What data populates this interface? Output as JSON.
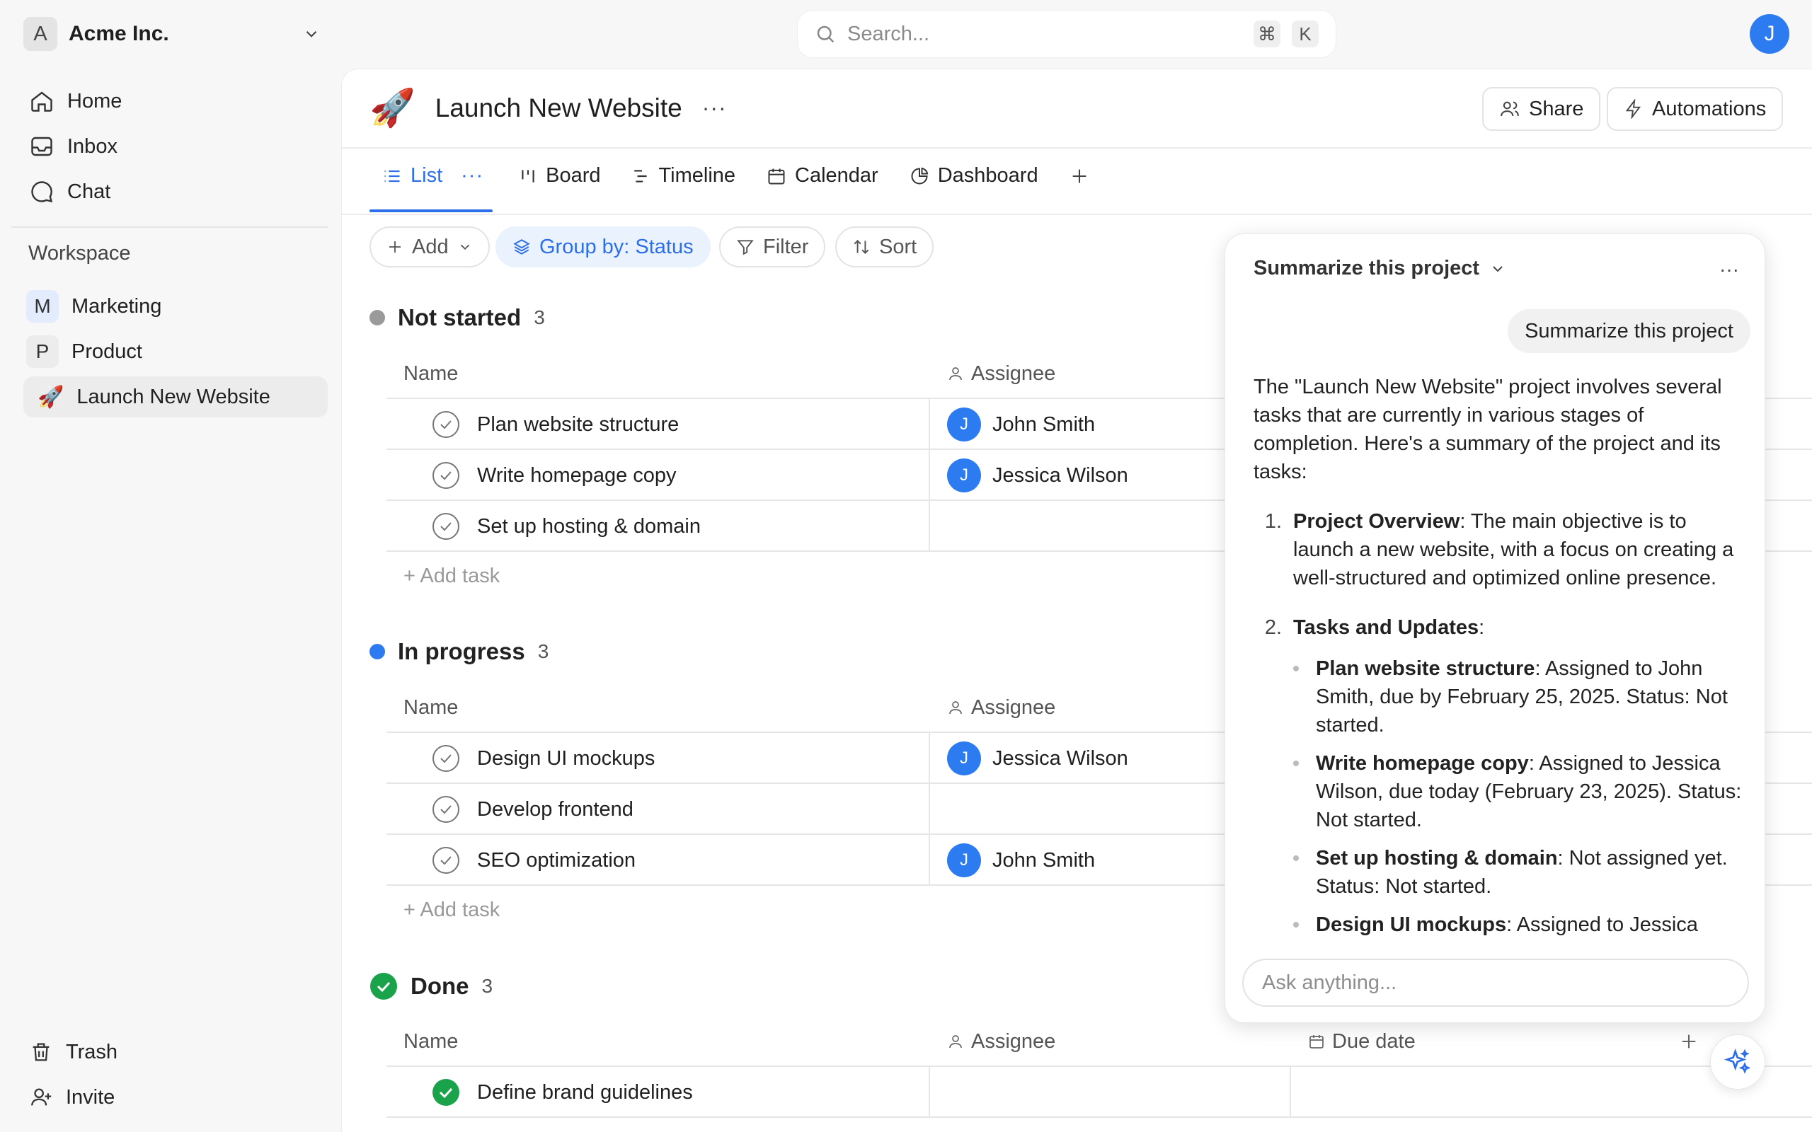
{
  "workspace": {
    "badge": "A",
    "name": "Acme Inc."
  },
  "search": {
    "placeholder": "Search...",
    "shortcut_cmd": "⌘",
    "shortcut_key": "K"
  },
  "user": {
    "initial": "J"
  },
  "sidebar": {
    "nav": [
      {
        "label": "Home"
      },
      {
        "label": "Inbox"
      },
      {
        "label": "Chat"
      }
    ],
    "workspace_heading": "Workspace",
    "workspace_items": [
      {
        "letter": "M",
        "label": "Marketing"
      },
      {
        "letter": "P",
        "label": "Product"
      },
      {
        "icon": "🚀",
        "label": "Launch New Website"
      }
    ],
    "bottom": [
      {
        "label": "Trash"
      },
      {
        "label": "Invite"
      }
    ]
  },
  "project": {
    "emoji": "🚀",
    "title": "Launch New Website",
    "more": "···",
    "share_label": "Share",
    "automations_label": "Automations"
  },
  "tabs": [
    {
      "label": "List",
      "more": "···"
    },
    {
      "label": "Board"
    },
    {
      "label": "Timeline"
    },
    {
      "label": "Calendar"
    },
    {
      "label": "Dashboard"
    }
  ],
  "toolbar": {
    "add_label": "Add",
    "group_label": "Group by: Status",
    "filter_label": "Filter",
    "sort_label": "Sort"
  },
  "columns": {
    "name": "Name",
    "assignee": "Assignee",
    "due": "Due date"
  },
  "groups": [
    {
      "title": "Not started",
      "count": "3",
      "add_task": "+ Add task",
      "tasks": [
        {
          "name": "Plan website structure",
          "assignee": "John Smith",
          "initial": "J"
        },
        {
          "name": "Write homepage copy",
          "assignee": "Jessica Wilson",
          "initial": "J"
        },
        {
          "name": "Set up hosting & domain",
          "assignee": "",
          "initial": ""
        }
      ]
    },
    {
      "title": "In progress",
      "count": "3",
      "add_task": "+ Add task",
      "tasks": [
        {
          "name": "Design UI mockups",
          "assignee": "Jessica Wilson",
          "initial": "J"
        },
        {
          "name": "Develop frontend",
          "assignee": "",
          "initial": ""
        },
        {
          "name": "SEO optimization",
          "assignee": "John Smith",
          "initial": "J"
        }
      ]
    },
    {
      "title": "Done",
      "count": "3",
      "tasks": [
        {
          "name": "Define brand guidelines",
          "assignee": "",
          "initial": ""
        }
      ]
    }
  ],
  "ai_panel": {
    "header": "Summarize this project",
    "more": "···",
    "user_message": "Summarize this project",
    "intro": "The \"Launch New Website\" project involves several tasks that are currently in various stages of completion. Here's a summary of the project and its tasks:",
    "items": [
      {
        "num": "1.",
        "bold": "Project Overview",
        "text": ": The main objective is to launch a new website, with a focus on creating a well-structured and optimized online presence."
      },
      {
        "num": "2.",
        "bold": "Tasks and Updates",
        "text": ":"
      }
    ],
    "bullets": [
      {
        "bold": "Plan website structure",
        "text": ": Assigned to John Smith, due by February 25, 2025. Status: Not started."
      },
      {
        "bold": "Write homepage copy",
        "text": ": Assigned to Jessica Wilson, due today (February 23, 2025). Status: Not started."
      },
      {
        "bold": "Set up hosting & domain",
        "text": ": Not assigned yet. Status: Not started."
      },
      {
        "bold": "Design UI mockups",
        "text": ": Assigned to Jessica"
      }
    ],
    "ask_placeholder": "Ask anything..."
  },
  "colors": {
    "accent": "#2d6fe8",
    "not_started": "#9a9a9a",
    "in_progress": "#2d7bf0",
    "done": "#1aa34a"
  }
}
